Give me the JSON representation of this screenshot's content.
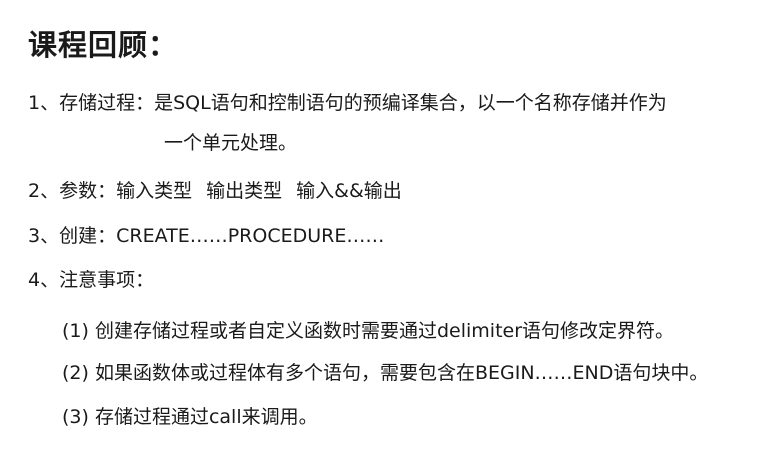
{
  "title": "课程回顾：",
  "items": [
    {
      "number": "1、",
      "label": "存储过程：",
      "text": "是SQL语句和控制语句的预编译集合，以一个名称存储并作为",
      "continuation": "一个单元处理。"
    },
    {
      "number": "2、",
      "label": "参数：",
      "parts": [
        "输入类型",
        "输出类型",
        "输入&&输出"
      ]
    },
    {
      "number": "3、",
      "label": "创建：",
      "text": "CREATE……PROCEDURE……"
    },
    {
      "number": "4、",
      "label": "注意事项："
    }
  ],
  "subitems": [
    {
      "number": "(1)",
      "text": "创建存储过程或者自定义函数时需要通过delimiter语句修改定界符。"
    },
    {
      "number": "(2)",
      "text": "如果函数体或过程体有多个语句，需要包含在BEGIN……END语句块中。"
    },
    {
      "number": "(3)",
      "text": "存储过程通过call来调用。"
    }
  ]
}
